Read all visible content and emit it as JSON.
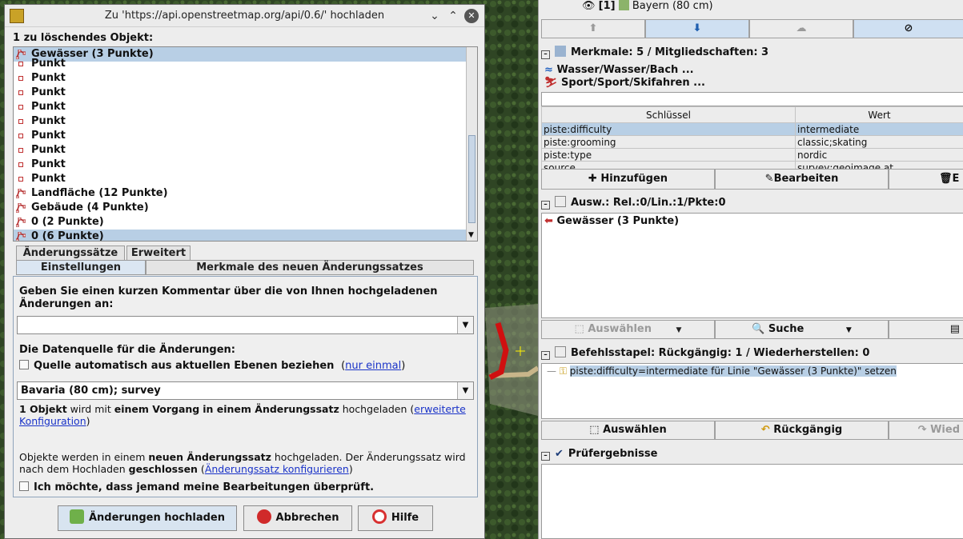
{
  "dialog": {
    "title": "Zu 'https://api.openstreetmap.org/api/0.6/' hochladen",
    "delete_label": "1 zu löschendes Objekt:",
    "objects": [
      {
        "text": "Gewässer (3 Punkte)",
        "type": "way",
        "selected": true
      },
      {
        "text": "Punkt",
        "type": "node"
      },
      {
        "text": "Punkt",
        "type": "node"
      },
      {
        "text": "Punkt",
        "type": "node"
      },
      {
        "text": "Punkt",
        "type": "node"
      },
      {
        "text": "Punkt",
        "type": "node"
      },
      {
        "text": "Punkt",
        "type": "node"
      },
      {
        "text": "Punkt",
        "type": "node"
      },
      {
        "text": "Punkt",
        "type": "node"
      },
      {
        "text": "Punkt",
        "type": "node"
      },
      {
        "text": "Landfläche (12 Punkte)",
        "type": "way"
      },
      {
        "text": "Gebäude (4 Punkte)",
        "type": "way"
      },
      {
        "text": "0 (2 Punkte)",
        "type": "way"
      },
      {
        "text": "0 (6 Punkte)",
        "type": "way",
        "selected": true
      }
    ],
    "tabs_top": [
      "Änderungssätze",
      "Erweitert"
    ],
    "tabs_sub": [
      "Einstellungen",
      "Merkmale des neuen Änderungssatzes"
    ],
    "comment_label": "Geben Sie einen kurzen Kommentar über die von Ihnen hochgeladenen Änderungen an:",
    "comment_value": "",
    "source_label": "Die Datenquelle für die Änderungen:",
    "auto_source_label": "Quelle automatisch aus aktuellen Ebenen beziehen",
    "once_link": "nur einmal",
    "source_value": "Bavaria (80 cm); survey",
    "info_bold1": "1 Objekt",
    "info_text1": "wird mit",
    "info_bold2": "einem Vorgang",
    "info_bold3": "in einem Änderungssatz",
    "info_text2": "hochgeladen",
    "info_link": "erweiterte Konfiguration",
    "changeset_text1": "Objekte werden in einem",
    "changeset_bold1": "neuen Änderungssatz",
    "changeset_text2": "hochgeladen. Der Änderungssatz wird nach dem Hochladen",
    "changeset_bold2": "geschlossen",
    "changeset_link": "Änderungssatz konfigurieren",
    "review_label": "Ich möchte, dass jemand meine Bearbeitungen überprüft.",
    "upload_button": "Änderungen hochladen",
    "cancel_button": "Abbrechen",
    "help_button": "Hilfe"
  },
  "right": {
    "layer_label": "[1]",
    "layer_name": "Bayern (80 cm)",
    "tags_header": "Merkmale: 5 / Mitgliedschaften: 3",
    "presets": [
      "Wasser/Wasser/Bach ...",
      "Sport/Sport/Skifahren ..."
    ],
    "col_key": "Schlüssel",
    "col_value": "Wert",
    "tags": [
      {
        "key": "piste:difficulty",
        "value": "intermediate",
        "selected": true
      },
      {
        "key": "piste:grooming",
        "value": "classic;skating"
      },
      {
        "key": "piste:type",
        "value": "nordic"
      },
      {
        "key": "source",
        "value": "survey;geoimage.at"
      }
    ],
    "add_button": "Hinzufügen",
    "edit_button": "Bearbeiten",
    "delete_button": "E",
    "selection_header": "Ausw.: Rel.:0/Lin.:1/Pkte:0",
    "selection_item": "Gewässer (3 Punkte)",
    "select_button": "Auswählen",
    "search_button": "Suche",
    "command_header": "Befehlsstapel: Rückgängig: 1 / Wiederherstellen: 0",
    "command_item": "piste:difficulty=intermediate für Linie \"Gewässer (3 Punkte)\" setzen",
    "cmd_select_button": "Auswählen",
    "undo_button": "Rückgängig",
    "redo_button": "Wied",
    "validator_header": "Prüfergebnisse"
  }
}
